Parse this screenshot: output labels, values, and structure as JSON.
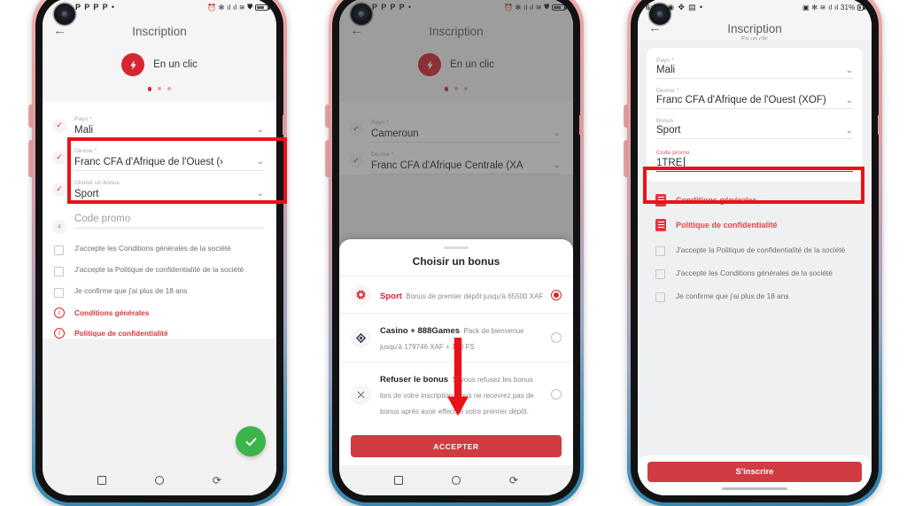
{
  "app": {
    "title": "Inscription",
    "subtitle": "En un clic",
    "brand_label": "En un clic",
    "brand_icon": "lightning-bolt-icon",
    "back_icon": "back-arrow-icon",
    "accent_red": "#d6262f",
    "highlight_red": "#e8121a",
    "green": "#3cb44a"
  },
  "phone1": {
    "statusbar": {
      "time": "",
      "notifications": [
        "P",
        "P",
        "P",
        "P",
        "•"
      ],
      "icons": [
        "alarm-icon",
        "bluetooth-icon",
        "signal-icon",
        "signal-icon",
        "vowifi-icon",
        "cast-icon",
        "battery-icon"
      ]
    },
    "fields": [
      {
        "badge": "✓",
        "label": "Pays *",
        "value": "Mali",
        "placeholder": ""
      },
      {
        "badge": "✓",
        "label": "Devise *",
        "value": "Franc CFA d'Afrique de l'Ouest (›",
        "placeholder": ""
      },
      {
        "badge": "✓",
        "label": "Choisir un bonus",
        "value": "Sport",
        "placeholder": ""
      },
      {
        "badge": "4",
        "label": "",
        "value": "",
        "placeholder": "Code promo"
      }
    ],
    "checkboxes": [
      "J'accepte les Conditions générales de la société",
      "J'accepte la Politique de confidentialité de la société",
      "Je confirme que j'ai plus de 18 ans"
    ],
    "links": [
      "Conditions générales",
      "Politique de confidentialité"
    ],
    "fab_icon": "checkmark-icon",
    "navbar": [
      "square-icon",
      "circle-icon",
      "back-icon"
    ]
  },
  "phone2": {
    "statusbar": {
      "time": "",
      "notifications": [
        "P",
        "P",
        "P",
        "P",
        "•"
      ]
    },
    "fields": [
      {
        "badge": "✓",
        "label": "Pays *",
        "value": "Cameroun"
      },
      {
        "badge": "✓",
        "label": "Devise *",
        "value": "Franc CFA d'Afrique Centrale (XA"
      }
    ],
    "sheet": {
      "title": "Choisir un bonus",
      "options": [
        {
          "icon": "sport-ball-icon",
          "name": "Sport",
          "name_color": "red",
          "desc": "Bonus de premier dépôt jusqu'à 65500 XAF",
          "selected": true
        },
        {
          "icon": "casino-diamond-icon",
          "name": "Casino + 888Games",
          "name_color": "dark",
          "desc": "Pack de bienvenue jusqu'à 179746 XAF + 150 FS",
          "selected": false
        },
        {
          "icon": "close-x-icon",
          "name": "Refuser le bonus",
          "name_color": "dark",
          "desc": "Si vous refusez les bonus lors de votre inscription, vous ne recevrez pas de bonus après avoir effectué votre premier dépôt.",
          "selected": false
        }
      ],
      "accept_label": "ACCEPTER"
    },
    "navbar": [
      "square-icon",
      "circle-icon",
      "back-icon"
    ]
  },
  "phone3": {
    "statusbar": {
      "time": "6:11",
      "icons": [
        "opera-icon",
        "settings-icon",
        "gallery-icon",
        "dot-icon"
      ],
      "right_icons": [
        "camera-icon",
        "bluetooth-icon",
        "wifi-icon",
        "signal-icon",
        "signal-icon"
      ],
      "battery": "31%"
    },
    "fields": [
      {
        "label": "Pays *",
        "value": "Mali",
        "label_color": "grey"
      },
      {
        "label": "Devise *",
        "value": "Franc CFA d'Afrique de l'Ouest (XOF)",
        "label_color": "grey"
      },
      {
        "label": "Bonus",
        "value": "Sport",
        "label_color": "grey"
      },
      {
        "label": "Code promo",
        "value": "1TRE",
        "label_color": "red",
        "focused": true
      }
    ],
    "links": [
      "Conditions générales",
      "Politique de confidentialité"
    ],
    "checkboxes": [
      "J'accepte la Politique de confidentialité de la société",
      "J'accepte les Conditions générales de la société",
      "Je confirme que j'ai plus de 18 ans"
    ],
    "signup_label": "S'inscrire"
  }
}
